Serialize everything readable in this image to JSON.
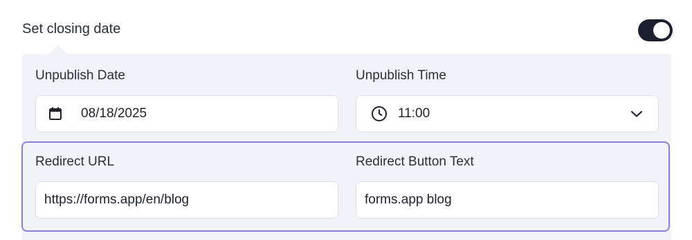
{
  "closing": {
    "label": "Set closing date",
    "toggle_on": true
  },
  "unpublish_date": {
    "label": "Unpublish Date",
    "value": "08/18/2025",
    "icon": "calendar-icon"
  },
  "unpublish_time": {
    "label": "Unpublish Time",
    "value": "11:00",
    "icon": "clock-icon",
    "dropdown_icon": "chevron-down-icon"
  },
  "redirect_url": {
    "label": "Redirect URL",
    "value": "https://forms.app/en/blog"
  },
  "redirect_button_text": {
    "label": "Redirect Button Text",
    "value": "forms.app blog"
  },
  "colors": {
    "accent_border": "#8b7fdd",
    "toggle_bg": "#1c1f2e",
    "panel_bg": "#f2f3f8"
  }
}
